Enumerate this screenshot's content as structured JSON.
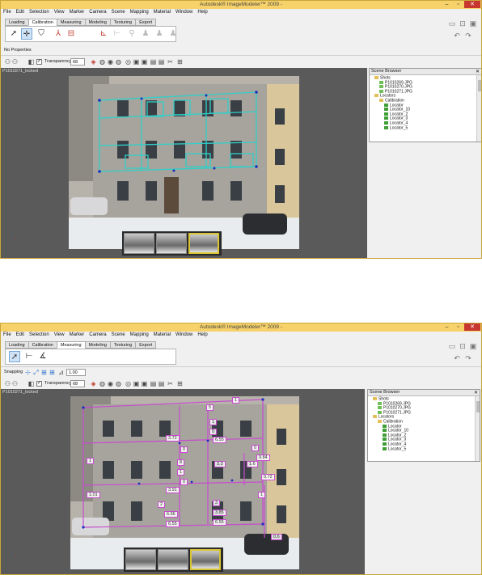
{
  "app_title": "Autodesk® ImageModeler™ 2009 -",
  "menu": [
    "File",
    "Edit",
    "Selection",
    "View",
    "Marker",
    "Camera",
    "Scene",
    "Mapping",
    "Material",
    "Window",
    "Help"
  ],
  "workflow_tabs": [
    "Loading",
    "Calibration",
    "Measuring",
    "Modeling",
    "Texturing",
    "Export"
  ],
  "window_top": {
    "active_tab": "Calibration",
    "properties_label": "No Properties",
    "transparency_label": "Transparency",
    "transparency_value": "68",
    "shot_label": "P1010271_locked"
  },
  "window_bottom": {
    "active_tab": "Measuring",
    "snapping_label": "Snapping",
    "scale_value": "1.00",
    "transparency_label": "Transparency",
    "transparency_value": "68",
    "shot_label": "P1010271_locked",
    "measurements": [
      "1",
      "5",
      "3.72",
      "1",
      "0",
      "0",
      "0",
      "6.55",
      "3.3",
      "1",
      "8",
      "0.72",
      "1",
      "1.6",
      "2",
      "6.56",
      "3",
      "3.85",
      "1",
      "0",
      "1.01",
      "6.55",
      "0.6",
      "6.55",
      "3.91",
      "9.84"
    ]
  },
  "scene_browser": {
    "title": "Scene Browser",
    "items": [
      {
        "label": "Shots",
        "level": 1,
        "icon": "folder-icon"
      },
      {
        "label": "P1010269.JPG",
        "level": 2,
        "icon": "jpg-icon"
      },
      {
        "label": "P1010270.JPG",
        "level": 2,
        "icon": "jpg-icon"
      },
      {
        "label": "P1010271.JPG",
        "level": 2,
        "icon": "jpg-icon"
      },
      {
        "label": "Locators",
        "level": 1,
        "icon": "folder-icon"
      },
      {
        "label": "Calibration",
        "level": 2,
        "icon": "folder-icon"
      },
      {
        "label": "Locator",
        "level": 3,
        "icon": "locator-icon"
      },
      {
        "label": "Locator_10",
        "level": 3,
        "icon": "locator-icon"
      },
      {
        "label": "Locator_2",
        "level": 3,
        "icon": "locator-icon"
      },
      {
        "label": "Locator_3",
        "level": 3,
        "icon": "locator-icon"
      },
      {
        "label": "Locator_4",
        "level": 3,
        "icon": "locator-icon"
      },
      {
        "label": "Locator_5",
        "level": 3,
        "icon": "locator-icon"
      }
    ]
  },
  "colors": {
    "titlebar": "#f7d26a",
    "calibration_overlay": "#2fd0c8",
    "measure_overlay": "#c84bcf",
    "locator_marker": "#1a2fbf"
  }
}
